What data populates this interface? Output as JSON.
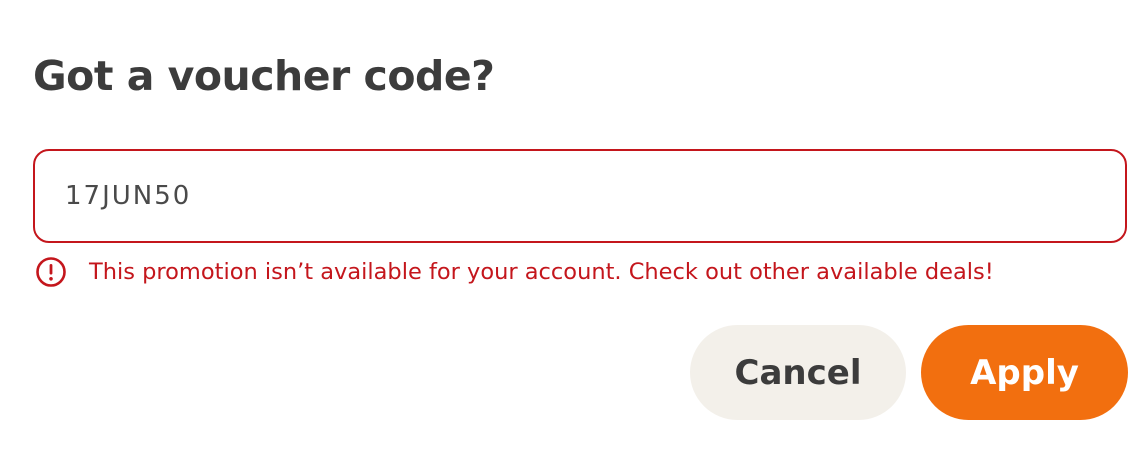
{
  "dialog": {
    "title": "Got a voucher code?"
  },
  "voucher_input": {
    "value": "17JUN50"
  },
  "error": {
    "icon": "alert-circle-icon",
    "message": "This promotion isn’t available for your account. Check out other available deals!",
    "color": "#c4161c"
  },
  "buttons": {
    "cancel_label": "Cancel",
    "apply_label": "Apply"
  },
  "colors": {
    "title": "#3c3c3c",
    "error": "#c4161c",
    "cancel_bg": "#f3f0ea",
    "apply_bg": "#f26f0f",
    "apply_text": "#ffffff"
  }
}
